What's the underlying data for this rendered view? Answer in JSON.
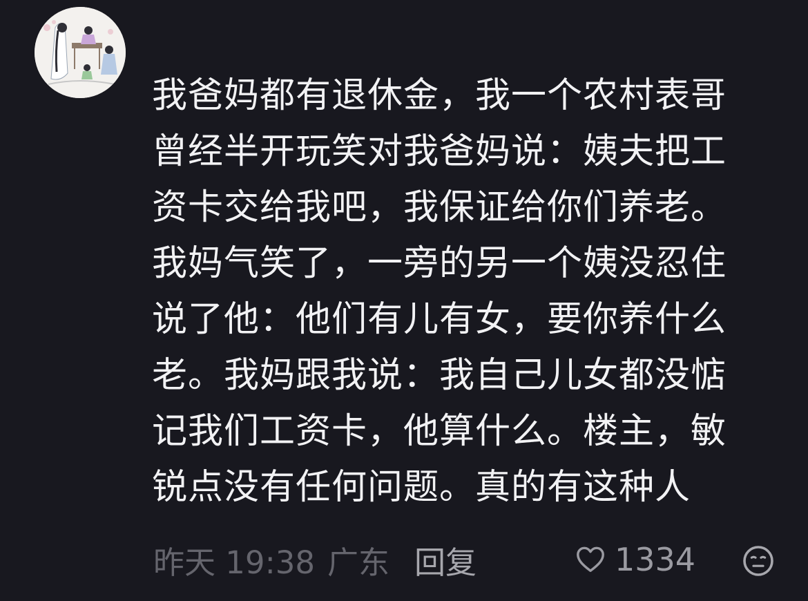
{
  "comment": {
    "text": "我爸妈都有退休金，我一个农村表哥\n曾经半开玩笑对我爸妈说：姨夫把工\n资卡交给我吧，我保证给你们养老。\n我妈气笑了，一旁的另一个姨没忍住\n说了他：他们有儿有女，要你养什么\n老。我妈跟我说：我自己儿女都没惦\n记我们工资卡，他算什么。楼主，敏\n锐点没有任何问题。真的有这种人",
    "time": "昨天 19:38",
    "location": "广东",
    "reply_label": "回复",
    "like_count": "1334"
  },
  "icons": {
    "avatar": "illustrated-figures-avatar",
    "like": "heart-outline-icon",
    "emoji": "neutral-face-icon"
  },
  "colors": {
    "background": "#18181f",
    "text": "#f2f2f4",
    "meta": "#65656d",
    "reply": "#a7a7ad",
    "like": "#9a9aa1"
  }
}
